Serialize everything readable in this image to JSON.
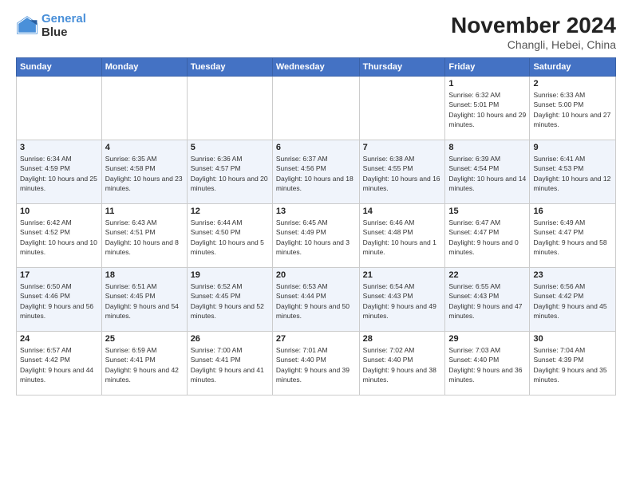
{
  "logo": {
    "line1": "General",
    "line2": "Blue"
  },
  "header": {
    "title": "November 2024",
    "subtitle": "Changli, Hebei, China"
  },
  "columns": [
    "Sunday",
    "Monday",
    "Tuesday",
    "Wednesday",
    "Thursday",
    "Friday",
    "Saturday"
  ],
  "weeks": [
    [
      {
        "day": "",
        "info": ""
      },
      {
        "day": "",
        "info": ""
      },
      {
        "day": "",
        "info": ""
      },
      {
        "day": "",
        "info": ""
      },
      {
        "day": "",
        "info": ""
      },
      {
        "day": "1",
        "info": "Sunrise: 6:32 AM\nSunset: 5:01 PM\nDaylight: 10 hours and 29 minutes."
      },
      {
        "day": "2",
        "info": "Sunrise: 6:33 AM\nSunset: 5:00 PM\nDaylight: 10 hours and 27 minutes."
      }
    ],
    [
      {
        "day": "3",
        "info": "Sunrise: 6:34 AM\nSunset: 4:59 PM\nDaylight: 10 hours and 25 minutes."
      },
      {
        "day": "4",
        "info": "Sunrise: 6:35 AM\nSunset: 4:58 PM\nDaylight: 10 hours and 23 minutes."
      },
      {
        "day": "5",
        "info": "Sunrise: 6:36 AM\nSunset: 4:57 PM\nDaylight: 10 hours and 20 minutes."
      },
      {
        "day": "6",
        "info": "Sunrise: 6:37 AM\nSunset: 4:56 PM\nDaylight: 10 hours and 18 minutes."
      },
      {
        "day": "7",
        "info": "Sunrise: 6:38 AM\nSunset: 4:55 PM\nDaylight: 10 hours and 16 minutes."
      },
      {
        "day": "8",
        "info": "Sunrise: 6:39 AM\nSunset: 4:54 PM\nDaylight: 10 hours and 14 minutes."
      },
      {
        "day": "9",
        "info": "Sunrise: 6:41 AM\nSunset: 4:53 PM\nDaylight: 10 hours and 12 minutes."
      }
    ],
    [
      {
        "day": "10",
        "info": "Sunrise: 6:42 AM\nSunset: 4:52 PM\nDaylight: 10 hours and 10 minutes."
      },
      {
        "day": "11",
        "info": "Sunrise: 6:43 AM\nSunset: 4:51 PM\nDaylight: 10 hours and 8 minutes."
      },
      {
        "day": "12",
        "info": "Sunrise: 6:44 AM\nSunset: 4:50 PM\nDaylight: 10 hours and 5 minutes."
      },
      {
        "day": "13",
        "info": "Sunrise: 6:45 AM\nSunset: 4:49 PM\nDaylight: 10 hours and 3 minutes."
      },
      {
        "day": "14",
        "info": "Sunrise: 6:46 AM\nSunset: 4:48 PM\nDaylight: 10 hours and 1 minute."
      },
      {
        "day": "15",
        "info": "Sunrise: 6:47 AM\nSunset: 4:47 PM\nDaylight: 9 hours and 0 minutes."
      },
      {
        "day": "16",
        "info": "Sunrise: 6:49 AM\nSunset: 4:47 PM\nDaylight: 9 hours and 58 minutes."
      }
    ],
    [
      {
        "day": "17",
        "info": "Sunrise: 6:50 AM\nSunset: 4:46 PM\nDaylight: 9 hours and 56 minutes."
      },
      {
        "day": "18",
        "info": "Sunrise: 6:51 AM\nSunset: 4:45 PM\nDaylight: 9 hours and 54 minutes."
      },
      {
        "day": "19",
        "info": "Sunrise: 6:52 AM\nSunset: 4:45 PM\nDaylight: 9 hours and 52 minutes."
      },
      {
        "day": "20",
        "info": "Sunrise: 6:53 AM\nSunset: 4:44 PM\nDaylight: 9 hours and 50 minutes."
      },
      {
        "day": "21",
        "info": "Sunrise: 6:54 AM\nSunset: 4:43 PM\nDaylight: 9 hours and 49 minutes."
      },
      {
        "day": "22",
        "info": "Sunrise: 6:55 AM\nSunset: 4:43 PM\nDaylight: 9 hours and 47 minutes."
      },
      {
        "day": "23",
        "info": "Sunrise: 6:56 AM\nSunset: 4:42 PM\nDaylight: 9 hours and 45 minutes."
      }
    ],
    [
      {
        "day": "24",
        "info": "Sunrise: 6:57 AM\nSunset: 4:42 PM\nDaylight: 9 hours and 44 minutes."
      },
      {
        "day": "25",
        "info": "Sunrise: 6:59 AM\nSunset: 4:41 PM\nDaylight: 9 hours and 42 minutes."
      },
      {
        "day": "26",
        "info": "Sunrise: 7:00 AM\nSunset: 4:41 PM\nDaylight: 9 hours and 41 minutes."
      },
      {
        "day": "27",
        "info": "Sunrise: 7:01 AM\nSunset: 4:40 PM\nDaylight: 9 hours and 39 minutes."
      },
      {
        "day": "28",
        "info": "Sunrise: 7:02 AM\nSunset: 4:40 PM\nDaylight: 9 hours and 38 minutes."
      },
      {
        "day": "29",
        "info": "Sunrise: 7:03 AM\nSunset: 4:40 PM\nDaylight: 9 hours and 36 minutes."
      },
      {
        "day": "30",
        "info": "Sunrise: 7:04 AM\nSunset: 4:39 PM\nDaylight: 9 hours and 35 minutes."
      }
    ]
  ]
}
